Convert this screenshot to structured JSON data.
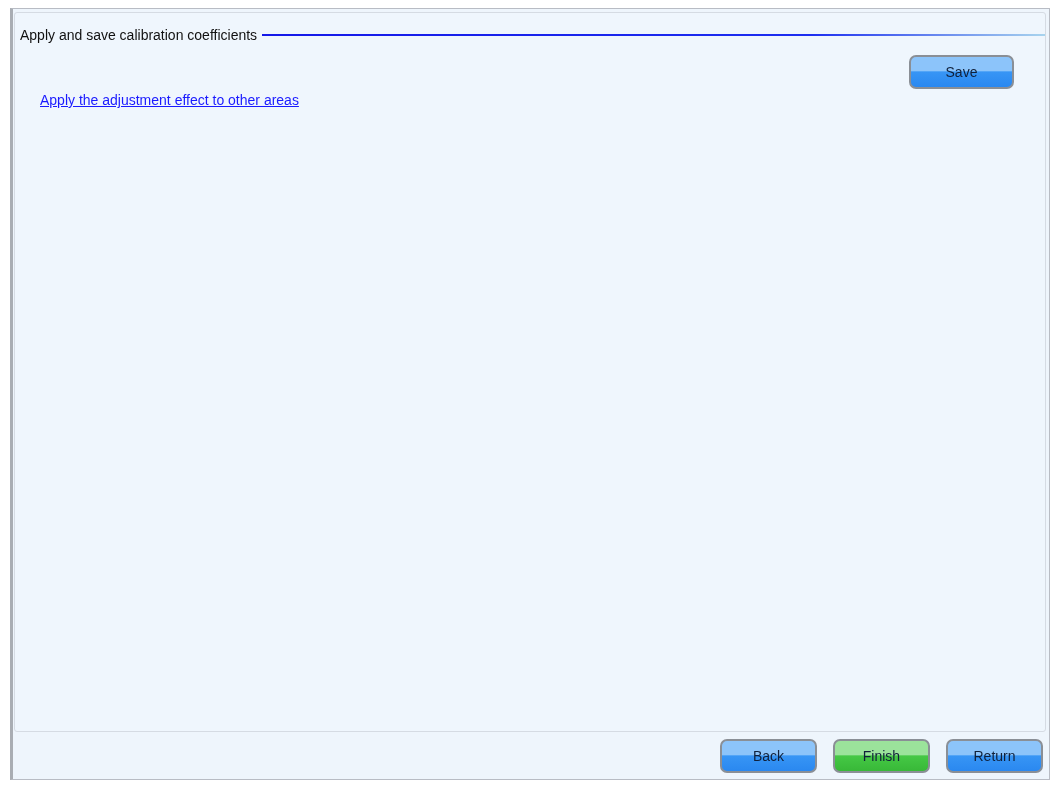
{
  "section": {
    "title": "Apply and save calibration coefficients"
  },
  "save_button": {
    "label": "Save",
    "kind": "blue"
  },
  "link": {
    "label": "Apply the adjustment effect to other areas"
  },
  "footer_buttons": [
    {
      "label": "Back",
      "kind": "blue"
    },
    {
      "label": "Finish",
      "kind": "green"
    },
    {
      "label": "Return",
      "kind": "blue"
    }
  ]
}
